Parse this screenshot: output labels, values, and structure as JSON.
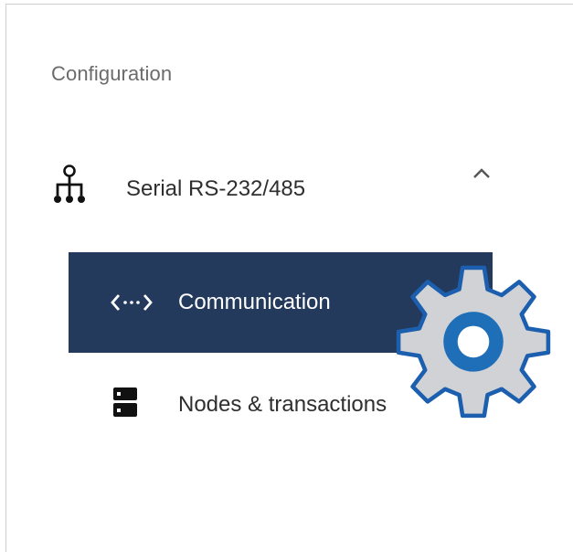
{
  "nav": {
    "section_title": "Configuration",
    "group": {
      "label": "Serial RS-232/485",
      "icon": "network-hierarchy-icon",
      "expanded": true
    },
    "items": [
      {
        "label": "Communication",
        "icon": "code-brackets-icon",
        "active": true
      },
      {
        "label": "Nodes & transactions",
        "icon": "server-icon",
        "active": false
      }
    ]
  },
  "colors": {
    "active_bg": "#233a5c",
    "gear_fill": "#d0d2d6",
    "gear_ring": "#1f6fb8"
  }
}
